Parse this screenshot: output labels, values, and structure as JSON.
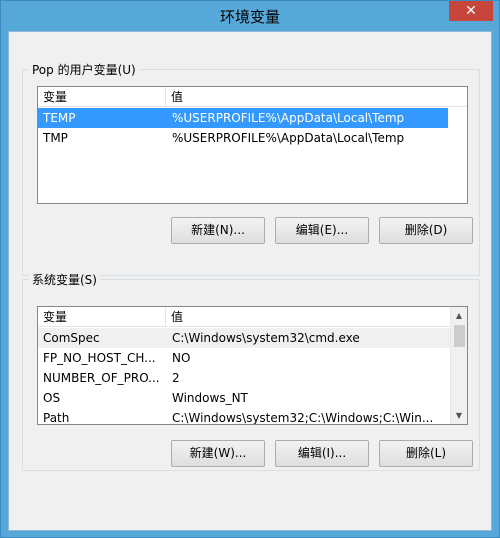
{
  "window": {
    "title": "环境变量",
    "close_label": "✕"
  },
  "user_section": {
    "title": "Pop 的用户变量(U)",
    "columns": [
      "变量",
      "值"
    ],
    "rows": [
      {
        "name": "TEMP",
        "value": "%USERPROFILE%\\AppData\\Local\\Temp"
      },
      {
        "name": "TMP",
        "value": "%USERPROFILE%\\AppData\\Local\\Temp"
      }
    ],
    "buttons": {
      "new": "新建(N)...",
      "edit": "编辑(E)...",
      "delete": "删除(D)"
    }
  },
  "system_section": {
    "title": "系统变量(S)",
    "columns": [
      "变量",
      "值"
    ],
    "rows": [
      {
        "name": "ComSpec",
        "value": "C:\\Windows\\system32\\cmd.exe"
      },
      {
        "name": "FP_NO_HOST_CH...",
        "value": "NO"
      },
      {
        "name": "NUMBER_OF_PRO...",
        "value": "2"
      },
      {
        "name": "OS",
        "value": "Windows_NT"
      },
      {
        "name": "Path",
        "value": "C:\\Windows\\system32;C:\\Windows;C:\\Win..."
      }
    ],
    "buttons": {
      "new": "新建(W)...",
      "edit": "编辑(I)...",
      "delete": "删除(L)"
    }
  },
  "colors": {
    "selection": "#3399ff",
    "title_bar": "#55a8d8",
    "close_button": "#c7463b"
  }
}
